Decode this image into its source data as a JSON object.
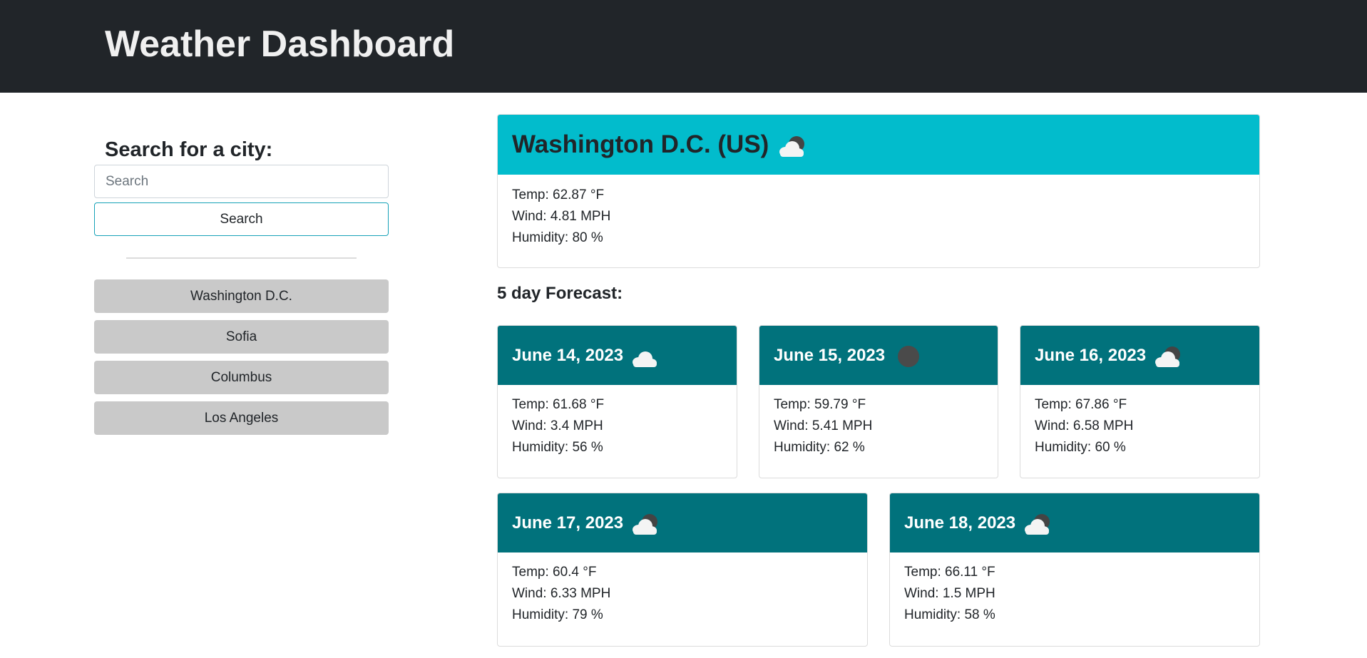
{
  "header": {
    "title": "Weather Dashboard"
  },
  "search": {
    "heading": "Search for a city:",
    "placeholder": "Search",
    "button_label": "Search"
  },
  "history": [
    {
      "label": "Washington D.C."
    },
    {
      "label": "Sofia"
    },
    {
      "label": "Columbus"
    },
    {
      "label": "Los Angeles"
    }
  ],
  "current": {
    "city": "Washington D.C. (US)",
    "icon": "partly-cloudy-night-icon",
    "temp": "Temp: 62.87 °F",
    "wind": "Wind: 4.81 MPH",
    "humidity": "Humidity: 80 %"
  },
  "forecast_heading": "5 day Forecast:",
  "forecast": [
    {
      "date": "June 14, 2023",
      "icon": "cloud-icon",
      "temp": "Temp: 61.68 °F",
      "wind": "Wind: 3.4 MPH",
      "humidity": "Humidity: 56 %"
    },
    {
      "date": "June 15, 2023",
      "icon": "moon-icon",
      "temp": "Temp: 59.79 °F",
      "wind": "Wind: 5.41 MPH",
      "humidity": "Humidity: 62 %"
    },
    {
      "date": "June 16, 2023",
      "icon": "partly-cloudy-night-icon",
      "temp": "Temp: 67.86 °F",
      "wind": "Wind: 6.58 MPH",
      "humidity": "Humidity: 60 %"
    },
    {
      "date": "June 17, 2023",
      "icon": "partly-cloudy-night-icon",
      "temp": "Temp: 60.4 °F",
      "wind": "Wind: 6.33 MPH",
      "humidity": "Humidity: 79 %"
    },
    {
      "date": "June 18, 2023",
      "icon": "partly-cloudy-night-icon",
      "temp": "Temp: 66.11 °F",
      "wind": "Wind: 1.5 MPH",
      "humidity": "Humidity: 58 %"
    }
  ],
  "colors": {
    "navbar": "#212529",
    "current_header": "#02bccc",
    "forecast_header": "#01727c",
    "history_button": "#c9c9c9",
    "search_border": "#17a2b8"
  }
}
